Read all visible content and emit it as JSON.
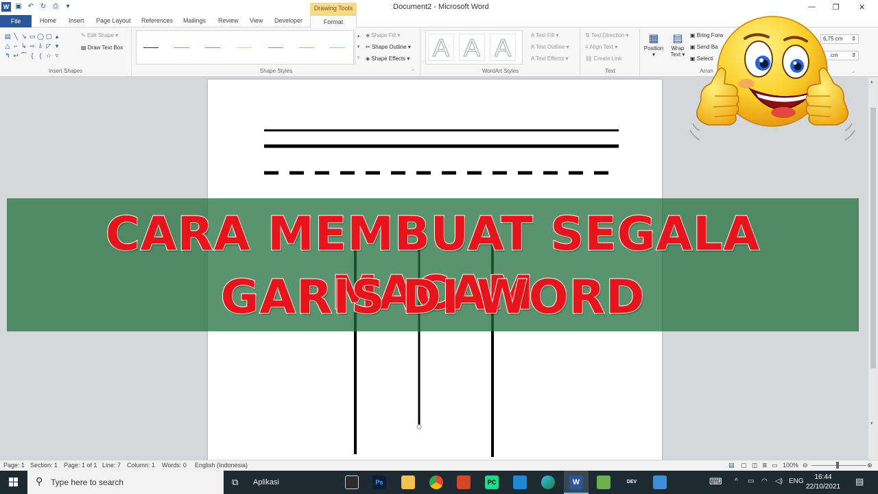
{
  "titlebar": {
    "doc_title": "Document2  -  Microsoft Word",
    "context_group": "Drawing Tools"
  },
  "tabs": [
    {
      "label": "File"
    },
    {
      "label": "Home"
    },
    {
      "label": "Insert"
    },
    {
      "label": "Page Layout"
    },
    {
      "label": "References"
    },
    {
      "label": "Mailings"
    },
    {
      "label": "Review"
    },
    {
      "label": "View"
    },
    {
      "label": "Developer"
    },
    {
      "label": "Format"
    }
  ],
  "ribbon": {
    "insert_shapes": {
      "edit_shape": "Edit Shape",
      "draw_text_box": "Draw Text Box",
      "label": "Insert Shapes"
    },
    "shape_styles": {
      "shape_fill": "Shape Fill",
      "shape_outline": "Shape Outline",
      "shape_effects": "Shape Effects",
      "label": "Shape Styles"
    },
    "wordart_styles": {
      "text_fill": "Text Fill",
      "text_outline": "Text Outline",
      "text_effects": "Text Effects",
      "label": "WordArt Styles",
      "glyph": "A"
    },
    "text": {
      "text_direction": "Text Direction",
      "align_text": "Align Text",
      "create_link": "Create Link",
      "label": "Text"
    },
    "arrange": {
      "position": "Position",
      "wrap_text": "Wrap Text",
      "bring_forward": "Bring Forw",
      "send_backward": "Send Ba",
      "selection": "Selecti",
      "label": "Arran"
    },
    "size": {
      "height": "6,75 cm",
      "width": "cm"
    }
  },
  "swatch_colors": [
    "#333333",
    "#6fa8dc",
    "#e06666",
    "#e6cc80",
    "#7a8ea6",
    "#93c47d",
    "#f6b26b"
  ],
  "banner": {
    "line1": "CARA MEMBUAT SEGALA MACAM",
    "line2": "GARIS DI WORD"
  },
  "statusbar": {
    "page": "Page: 1",
    "section": "Section: 1",
    "pages": "Page: 1 of 1",
    "line": "Line: 7",
    "column": "Column: 1",
    "words": "Words: 0",
    "language": "English (Indonesia)",
    "zoom": "100%"
  },
  "taskbar": {
    "search_placeholder": "Type here to search",
    "task_view_label": "Aplikasi",
    "lang": "ENG",
    "time": "16:44",
    "date": "22/10/2021"
  }
}
